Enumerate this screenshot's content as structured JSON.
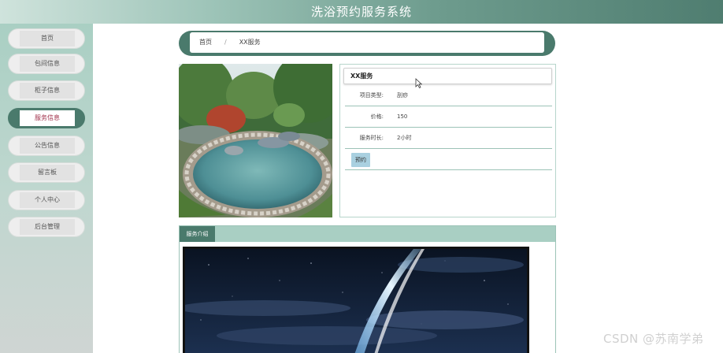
{
  "app": {
    "title": "洗浴预约服务系统"
  },
  "sidebar": {
    "items": [
      {
        "label": "首页",
        "active": false
      },
      {
        "label": "包间信息",
        "active": false
      },
      {
        "label": "柜子信息",
        "active": false
      },
      {
        "label": "服务信息",
        "active": true
      },
      {
        "label": "公告信息",
        "active": false
      },
      {
        "label": "留言板",
        "active": false
      },
      {
        "label": "个人中心",
        "active": false
      },
      {
        "label": "后台管理",
        "active": false
      }
    ]
  },
  "breadcrumb": {
    "home": "首页",
    "separator": "/",
    "current": "XX服务"
  },
  "service": {
    "name": "XX服务",
    "fields": [
      {
        "label": "项目类型:",
        "value": "刮痧"
      },
      {
        "label": "价格:",
        "value": "150"
      },
      {
        "label": "服务时长:",
        "value": "2小时"
      }
    ],
    "book_label": "预约"
  },
  "intro": {
    "tab_label": "服务介绍"
  },
  "watermark": "CSDN @苏南学弟",
  "colors": {
    "accent": "#4a7a6c",
    "accent_light": "#a9cfc3",
    "active_text": "#a0304a",
    "book_button": "#a9d0e0"
  },
  "icons": {
    "cursor": "mouse-pointer-icon"
  }
}
